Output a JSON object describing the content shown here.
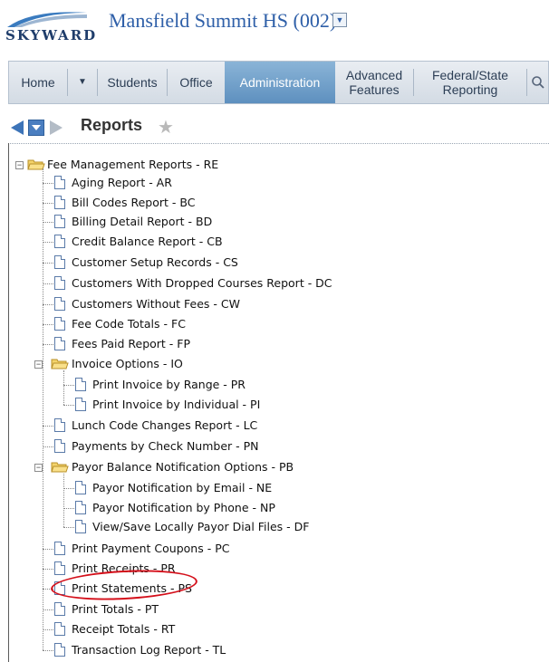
{
  "header": {
    "logo_text": "SKYWARD",
    "school": "Mansfield Summit HS (002)",
    "school_dropdown_icon": "chevron-down-icon"
  },
  "nav": {
    "tabs": [
      {
        "label": "Home",
        "active": false
      },
      {
        "label": "Students",
        "active": false
      },
      {
        "label": "Office",
        "active": false
      },
      {
        "label": "Administration",
        "active": true
      },
      {
        "label": "Advanced Features",
        "active": false
      },
      {
        "label": "Federal/State Reporting",
        "active": false
      }
    ]
  },
  "page": {
    "title": "Reports"
  },
  "tree": {
    "root": "Fee Management Reports - RE",
    "items": [
      "Aging Report - AR",
      "Bill Codes Report - BC",
      "Billing Detail Report - BD",
      "Credit Balance Report - CB",
      "Customer Setup Records - CS",
      "Customers With Dropped Courses Report - DC",
      "Customers Without Fees - CW",
      "Fee Code Totals - FC",
      "Fees Paid Report - FP",
      "Invoice Options - IO",
      "Print Invoice by Range - PR",
      "Print Invoice by Individual - PI",
      "Lunch Code Changes Report - LC",
      "Payments by Check Number - PN",
      "Payor Balance Notification Options - PB",
      "Payor Notification by Email - NE",
      "Payor Notification by Phone - NP",
      "View/Save Locally Payor Dial Files - DF",
      "Print Payment Coupons - PC",
      "Print Receipts - PR",
      "Print Statements - PS",
      "Print Totals - PT",
      "Receipt Totals - RT",
      "Transaction Log Report - TL"
    ]
  },
  "highlight": {
    "color": "#d40f1a"
  }
}
